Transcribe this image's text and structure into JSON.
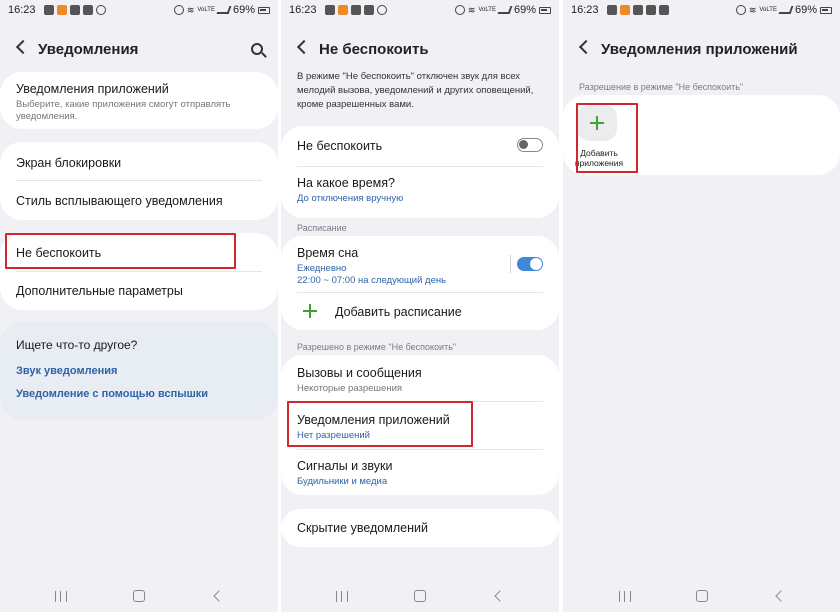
{
  "status": {
    "screen1": {
      "time": "16:23",
      "battery": "69%",
      "carrier": "VoLTE"
    },
    "screen2": {
      "time": "16:23",
      "battery": "69%",
      "carrier": "VoLTE"
    },
    "screen3": {
      "time": "16:23",
      "battery": "69%",
      "carrier": "VoLTE"
    }
  },
  "screen1": {
    "title": "Уведомления",
    "app_notifications": {
      "title": "Уведомления приложений",
      "subtitle": "Выберите, какие приложения смогут отправлять уведомления."
    },
    "lock_screen": "Экран блокировки",
    "popup_style": "Стиль всплывающего уведомления",
    "dnd": "Не беспокоить",
    "advanced": "Дополнительные параметры",
    "looking_for": "Ищете что-то другое?",
    "link_sound": "Звук уведомления",
    "link_flash": "Уведомление с помощью вспышки"
  },
  "screen2": {
    "title": "Не беспокоить",
    "intro": "В режиме \"Не беспокоить\" отключен звук для всех мелодий вызова, уведомлений и других оповещений, кроме разрешенных вами.",
    "dnd_toggle": {
      "label": "Не беспокоить",
      "on": false
    },
    "duration": {
      "title": "На какое время?",
      "subtitle": "До отключения вручную"
    },
    "schedule_label": "Расписание",
    "sleep": {
      "title": "Время сна",
      "subtitle1": "Ежедневно",
      "subtitle2": "22:00 ~ 07:00 на следующий день",
      "on": true
    },
    "add_schedule": "Добавить расписание",
    "allowed_label": "Разрешено в режиме \"Не беспокоить\"",
    "calls": {
      "title": "Вызовы и сообщения",
      "subtitle": "Некоторые разрешения"
    },
    "apps": {
      "title": "Уведомления приложений",
      "subtitle": "Нет разрешений"
    },
    "sounds": {
      "title": "Сигналы и звуки",
      "subtitle": "Будильники и медиа"
    },
    "hide": "Скрытие уведомлений"
  },
  "screen3": {
    "title": "Уведомления приложений",
    "allowed_label": "Разрешение в режиме \"Не беспокоить\"",
    "add_apps": "Добавить приложения"
  },
  "colors": {
    "accent": "#2f63a6",
    "highlight": "#d1262d",
    "toggle_on": "#3f88d8",
    "plus": "#3aa33a"
  }
}
